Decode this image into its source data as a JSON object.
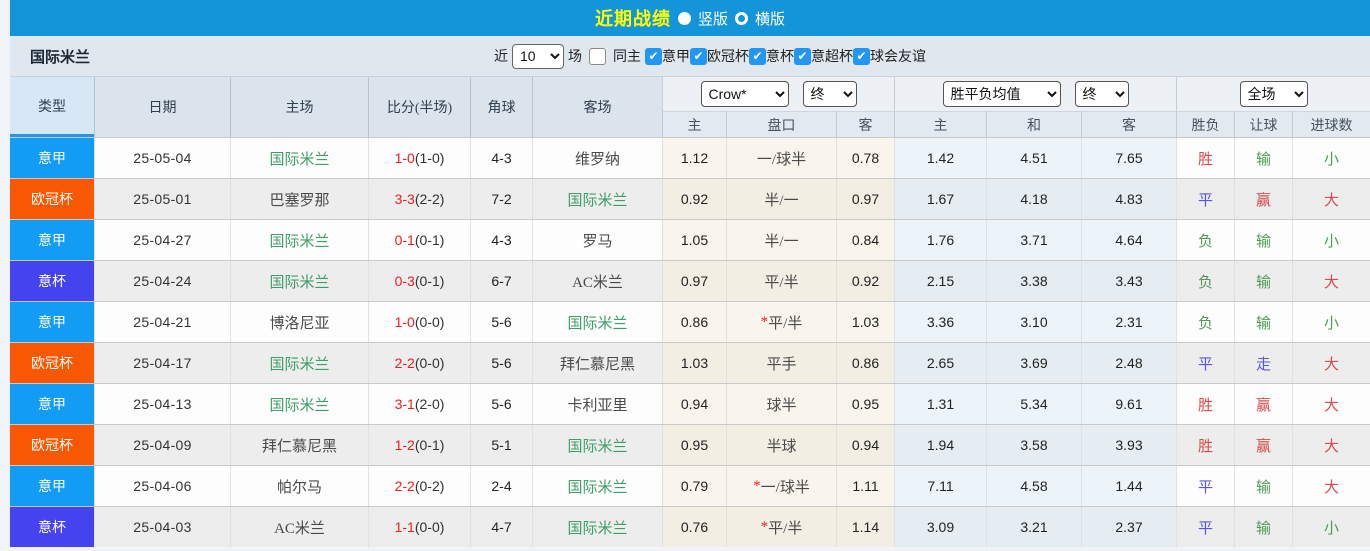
{
  "topbar": {
    "title": "近期战绩",
    "radios": [
      {
        "label": "竖版",
        "selected": true
      },
      {
        "label": "横版",
        "selected": false
      }
    ]
  },
  "filterbar": {
    "team_title": "国际米兰",
    "near_label": "近",
    "count_value": "10",
    "count_unit_label": "场",
    "same_home": {
      "label": "同主",
      "checked": false
    },
    "leagues": [
      {
        "label": "意甲",
        "checked": true
      },
      {
        "label": "欧冠杯",
        "checked": true
      },
      {
        "label": "意杯",
        "checked": true
      },
      {
        "label": "意超杯",
        "checked": true
      },
      {
        "label": "球会友谊",
        "checked": true
      }
    ],
    "check_glyph": "✔"
  },
  "table": {
    "main_headers": [
      "类型",
      "日期",
      "主场",
      "比分(半场)",
      "角球",
      "客场"
    ],
    "dropdowns": {
      "bookmaker": "Crow*",
      "bookmaker_state": "终",
      "avg": "胜平负均值",
      "avg_state": "终",
      "scope": "全场"
    },
    "sub_headers": [
      "主",
      "盘口",
      "客",
      "主",
      "和",
      "客",
      "胜负",
      "让球",
      "进球数"
    ],
    "rows": [
      {
        "league": "意甲",
        "lcls": "lg-blue",
        "date": "25-05-04",
        "home": "国际米兰",
        "hcls": "inter",
        "score": "1-0",
        "half": "(1-0)",
        "corner": "4-3",
        "away": "维罗纳",
        "acls": "other",
        "o1": "1.12",
        "star": "",
        "pan": "一/球半",
        "o3": "0.78",
        "a1": "1.42",
        "a2": "4.51",
        "a3": "7.65",
        "r1": "胜",
        "r1c": "c-red",
        "r2": "输",
        "r2c": "c-green",
        "r3": "小",
        "r3c": "c-green"
      },
      {
        "league": "欧冠杯",
        "lcls": "lg-orange",
        "date": "25-05-01",
        "home": "巴塞罗那",
        "hcls": "other",
        "score": "3-3",
        "half": "(2-2)",
        "corner": "7-2",
        "away": "国际米兰",
        "acls": "inter",
        "o1": "0.92",
        "star": "",
        "pan": "半/一",
        "o3": "0.97",
        "a1": "1.67",
        "a2": "4.18",
        "a3": "4.83",
        "r1": "平",
        "r1c": "c-blue",
        "r2": "赢",
        "r2c": "c-red",
        "r3": "大",
        "r3c": "c-red"
      },
      {
        "league": "意甲",
        "lcls": "lg-blue",
        "date": "25-04-27",
        "home": "国际米兰",
        "hcls": "inter",
        "score": "0-1",
        "half": "(0-1)",
        "corner": "4-3",
        "away": "罗马",
        "acls": "other",
        "o1": "1.05",
        "star": "",
        "pan": "半/一",
        "o3": "0.84",
        "a1": "1.76",
        "a2": "3.71",
        "a3": "4.64",
        "r1": "负",
        "r1c": "c-green",
        "r2": "输",
        "r2c": "c-green",
        "r3": "小",
        "r3c": "c-green"
      },
      {
        "league": "意杯",
        "lcls": "lg-violet",
        "date": "25-04-24",
        "home": "国际米兰",
        "hcls": "inter",
        "score": "0-3",
        "half": "(0-1)",
        "corner": "6-7",
        "away": "AC米兰",
        "acls": "other",
        "o1": "0.97",
        "star": "",
        "pan": "平/半",
        "o3": "0.92",
        "a1": "2.15",
        "a2": "3.38",
        "a3": "3.43",
        "r1": "负",
        "r1c": "c-green",
        "r2": "输",
        "r2c": "c-green",
        "r3": "大",
        "r3c": "c-red"
      },
      {
        "league": "意甲",
        "lcls": "lg-blue",
        "date": "25-04-21",
        "home": "博洛尼亚",
        "hcls": "other",
        "score": "1-0",
        "half": "(0-0)",
        "corner": "5-6",
        "away": "国际米兰",
        "acls": "inter",
        "o1": "0.86",
        "star": "*",
        "pan": "平/半",
        "o3": "1.03",
        "a1": "3.36",
        "a2": "3.10",
        "a3": "2.31",
        "r1": "负",
        "r1c": "c-green",
        "r2": "输",
        "r2c": "c-green",
        "r3": "小",
        "r3c": "c-green"
      },
      {
        "league": "欧冠杯",
        "lcls": "lg-orange",
        "date": "25-04-17",
        "home": "国际米兰",
        "hcls": "inter",
        "score": "2-2",
        "half": "(0-0)",
        "corner": "5-6",
        "away": "拜仁慕尼黑",
        "acls": "other",
        "o1": "1.03",
        "star": "",
        "pan": "平手",
        "o3": "0.86",
        "a1": "2.65",
        "a2": "3.69",
        "a3": "2.48",
        "r1": "平",
        "r1c": "c-blue",
        "r2": "走",
        "r2c": "c-blue",
        "r3": "大",
        "r3c": "c-red"
      },
      {
        "league": "意甲",
        "lcls": "lg-blue",
        "date": "25-04-13",
        "home": "国际米兰",
        "hcls": "inter",
        "score": "3-1",
        "half": "(2-0)",
        "corner": "5-6",
        "away": "卡利亚里",
        "acls": "other",
        "o1": "0.94",
        "star": "",
        "pan": "球半",
        "o3": "0.95",
        "a1": "1.31",
        "a2": "5.34",
        "a3": "9.61",
        "r1": "胜",
        "r1c": "c-red",
        "r2": "赢",
        "r2c": "c-red",
        "r3": "大",
        "r3c": "c-red"
      },
      {
        "league": "欧冠杯",
        "lcls": "lg-orange",
        "date": "25-04-09",
        "home": "拜仁慕尼黑",
        "hcls": "other",
        "score": "1-2",
        "half": "(0-1)",
        "corner": "5-1",
        "away": "国际米兰",
        "acls": "inter",
        "o1": "0.95",
        "star": "",
        "pan": "半球",
        "o3": "0.94",
        "a1": "1.94",
        "a2": "3.58",
        "a3": "3.93",
        "r1": "胜",
        "r1c": "c-red",
        "r2": "赢",
        "r2c": "c-red",
        "r3": "大",
        "r3c": "c-red"
      },
      {
        "league": "意甲",
        "lcls": "lg-blue",
        "date": "25-04-06",
        "home": "帕尔马",
        "hcls": "other",
        "score": "2-2",
        "half": "(0-2)",
        "corner": "2-4",
        "away": "国际米兰",
        "acls": "inter",
        "o1": "0.79",
        "star": "*",
        "pan": "一/球半",
        "o3": "1.11",
        "a1": "7.11",
        "a2": "4.58",
        "a3": "1.44",
        "r1": "平",
        "r1c": "c-blue",
        "r2": "输",
        "r2c": "c-green",
        "r3": "大",
        "r3c": "c-red"
      },
      {
        "league": "意杯",
        "lcls": "lg-violet",
        "date": "25-04-03",
        "home": "AC米兰",
        "hcls": "other",
        "score": "1-1",
        "half": "(0-0)",
        "corner": "4-7",
        "away": "国际米兰",
        "acls": "inter",
        "o1": "0.76",
        "star": "*",
        "pan": "平/半",
        "o3": "1.14",
        "a1": "3.09",
        "a2": "3.21",
        "a3": "2.37",
        "r1": "平",
        "r1c": "c-blue",
        "r2": "输",
        "r2c": "c-green",
        "r3": "小",
        "r3c": "c-green"
      }
    ]
  },
  "colors": {
    "topbar_blue": "#1495d9",
    "title_yellow": "#ffff00",
    "serie_a_badge": "#129cf3",
    "ucl_badge": "#f85803",
    "coppa_badge": "#4543ef",
    "inter_green": "#3e9e68",
    "score_red": "#f31b1b",
    "result_red": "#d84b4b",
    "result_green": "#4f9a58",
    "result_blue": "#5a55e0",
    "odds_cream_bg": "#faf5ec",
    "avg_blue_bg": "#ecf4f9"
  }
}
